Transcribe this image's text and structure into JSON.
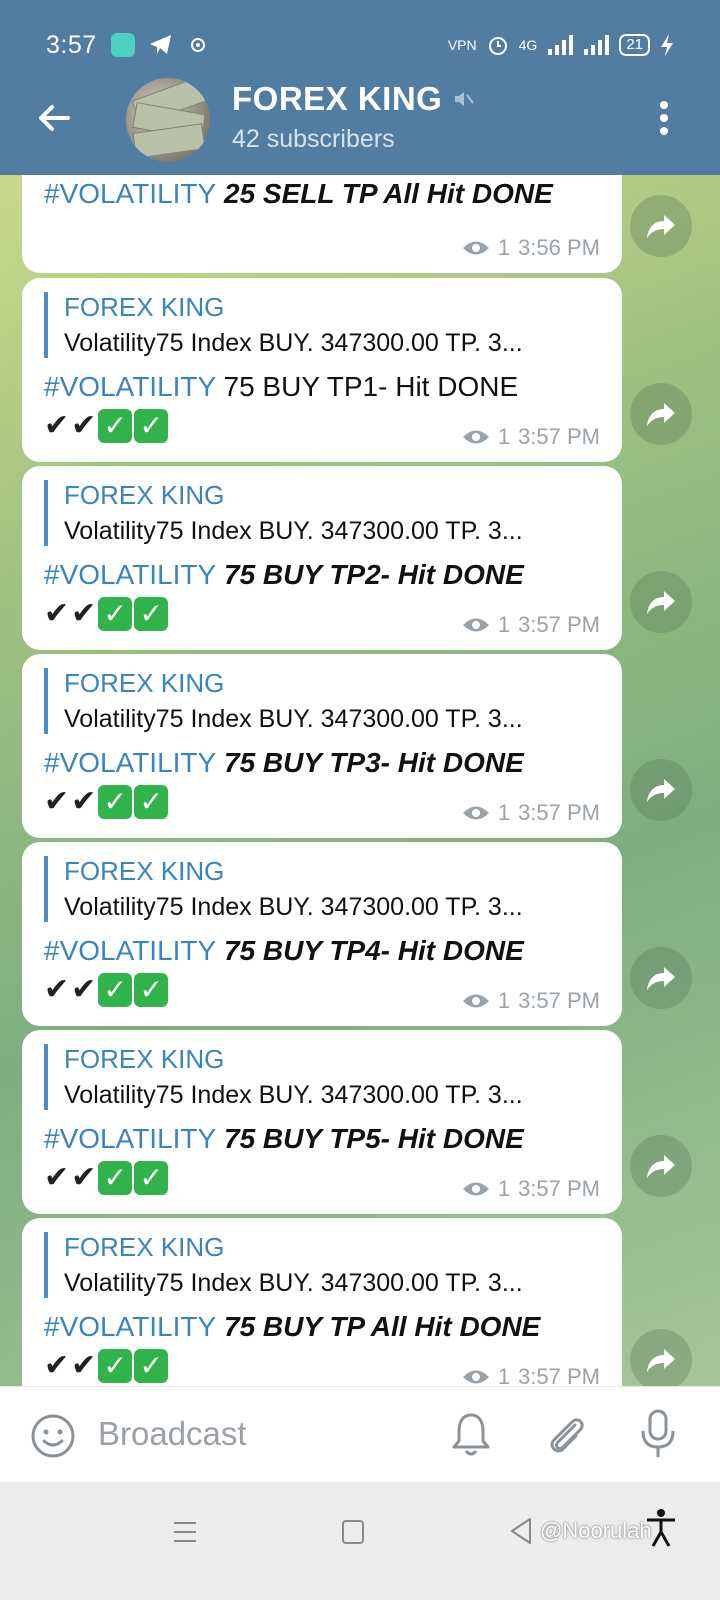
{
  "status": {
    "time": "3:57",
    "battery": "21",
    "network": "4G"
  },
  "header": {
    "title": "FOREX KING",
    "subtitle": "42 subscribers"
  },
  "messages": [
    {
      "quote_name": "",
      "quote_text": "",
      "tag": "#VOLATILITY",
      "plain": "",
      "italic": " 25 SELL TP All Hit DONE",
      "views": "1",
      "time": "3:56 PM"
    },
    {
      "quote_name": "FOREX KING",
      "quote_text": "Volatility75 Index BUY. 347300.00  TP.    3...",
      "tag": "#VOLATILITY",
      "plain": " 75 BUY TP1- Hit DONE",
      "italic": "",
      "views": "1",
      "time": "3:57 PM"
    },
    {
      "quote_name": "FOREX KING",
      "quote_text": "Volatility75 Index BUY. 347300.00  TP.    3...",
      "tag": "#VOLATILITY",
      "plain": "",
      "italic": " 75 BUY TP2- Hit DONE",
      "views": "1",
      "time": "3:57 PM"
    },
    {
      "quote_name": "FOREX KING",
      "quote_text": "Volatility75 Index BUY. 347300.00  TP.    3...",
      "tag": "#VOLATILITY",
      "plain": "",
      "italic": " 75 BUY TP3- Hit DONE",
      "views": "1",
      "time": "3:57 PM"
    },
    {
      "quote_name": "FOREX KING",
      "quote_text": "Volatility75 Index BUY. 347300.00  TP.    3...",
      "tag": "#VOLATILITY",
      "plain": "",
      "italic": " 75 BUY TP4- Hit DONE",
      "views": "1",
      "time": "3:57 PM"
    },
    {
      "quote_name": "FOREX KING",
      "quote_text": "Volatility75 Index BUY. 347300.00  TP.    3...",
      "tag": "#VOLATILITY",
      "plain": "",
      "italic": " 75 BUY TP5- Hit DONE",
      "views": "1",
      "time": "3:57 PM"
    },
    {
      "quote_name": "FOREX KING",
      "quote_text": "Volatility75 Index BUY. 347300.00  TP.    3...",
      "tag": "#VOLATILITY",
      "plain": "",
      "italic": " 75 BUY TP All Hit DONE",
      "views": "1",
      "time": "3:57 PM"
    }
  ],
  "input": {
    "placeholder": "Broadcast"
  },
  "watermark": "@Noorulah",
  "colors": {
    "header": "#527da3",
    "accent": "#3a84c0",
    "check_green": "#2fb34a"
  },
  "icons": [
    "back-arrow-icon",
    "mute-icon",
    "more-vert-icon",
    "eye-icon",
    "share-icon",
    "emoji-icon",
    "bell-icon",
    "attach-icon",
    "mic-icon"
  ]
}
